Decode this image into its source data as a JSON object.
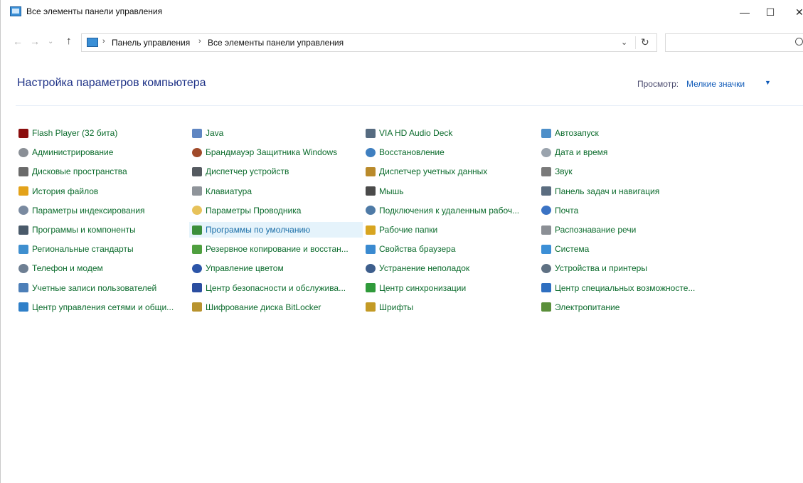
{
  "window": {
    "title": "Все элементы панели управления",
    "controls": {
      "minimize": "—",
      "maximize": "☐",
      "close": "✕"
    }
  },
  "nav": {
    "back": "←",
    "forward": "→",
    "recent": "⌄",
    "up": "↑",
    "breadcrumb_sep": "›",
    "breadcrumbs": [
      "Панель управления",
      "Все элементы панели управления"
    ],
    "dropdown": "⌄",
    "refresh": "↻",
    "search_placeholder": ""
  },
  "header": {
    "title": "Настройка параметров компьютера",
    "view_label": "Просмотр:",
    "view_value": "Мелкие значки",
    "view_caret": "▼"
  },
  "columns": [
    {
      "items": [
        {
          "label": "Flash Player (32 бита)",
          "icon": "flash-player-icon",
          "color": "#8b0d0d"
        },
        {
          "label": "Администрирование",
          "icon": "administrative-tools-icon",
          "color": "#8a8f96"
        },
        {
          "label": "Дисковые пространства",
          "icon": "storage-spaces-icon",
          "color": "#6a6a6a"
        },
        {
          "label": "История файлов",
          "icon": "file-history-icon",
          "color": "#e3a21a"
        },
        {
          "label": "Параметры индексирования",
          "icon": "indexing-options-icon",
          "color": "#7a8aa0"
        },
        {
          "label": "Программы и компоненты",
          "icon": "programs-features-icon",
          "color": "#4a5a6a"
        },
        {
          "label": "Региональные стандарты",
          "icon": "region-icon",
          "color": "#3f8fcf"
        },
        {
          "label": "Телефон и модем",
          "icon": "phone-modem-icon",
          "color": "#6e7f93"
        },
        {
          "label": "Учетные записи пользователей",
          "icon": "user-accounts-icon",
          "color": "#4d7fb8"
        },
        {
          "label": "Центр управления сетями и общи...",
          "icon": "network-center-icon",
          "color": "#2f7fc8"
        }
      ]
    },
    {
      "items": [
        {
          "label": "Java",
          "icon": "java-icon",
          "color": "#5f86c2"
        },
        {
          "label": "Брандмауэр Защитника Windows",
          "icon": "firewall-icon",
          "color": "#a04a2a"
        },
        {
          "label": "Диспетчер устройств",
          "icon": "device-manager-icon",
          "color": "#555a60"
        },
        {
          "label": "Клавиатура",
          "icon": "keyboard-icon",
          "color": "#8f949a"
        },
        {
          "label": "Параметры Проводника",
          "icon": "explorer-options-icon",
          "color": "#e7c25a"
        },
        {
          "label": "Программы по умолчанию",
          "icon": "default-programs-icon",
          "color": "#3b8f3b",
          "highlighted": true
        },
        {
          "label": "Резервное копирование и восстан...",
          "icon": "backup-restore-icon",
          "color": "#4f9f3f"
        },
        {
          "label": "Управление цветом",
          "icon": "color-management-icon",
          "color": "#2c55a8"
        },
        {
          "label": "Центр безопасности и обслужива...",
          "icon": "security-maintenance-icon",
          "color": "#2b4ea0"
        },
        {
          "label": "Шифрование диска BitLocker",
          "icon": "bitlocker-icon",
          "color": "#b8932e"
        }
      ]
    },
    {
      "items": [
        {
          "label": "VIA HD Audio Deck",
          "icon": "audio-deck-icon",
          "color": "#566b80"
        },
        {
          "label": "Восстановление",
          "icon": "recovery-icon",
          "color": "#3f7fc0"
        },
        {
          "label": "Диспетчер учетных данных",
          "icon": "credential-manager-icon",
          "color": "#b98a2b"
        },
        {
          "label": "Мышь",
          "icon": "mouse-icon",
          "color": "#4a4a4a"
        },
        {
          "label": "Подключения к удаленным рабоч...",
          "icon": "remote-desktop-icon",
          "color": "#4e7aa6"
        },
        {
          "label": "Рабочие папки",
          "icon": "work-folders-icon",
          "color": "#d8a520"
        },
        {
          "label": "Свойства браузера",
          "icon": "internet-options-icon",
          "color": "#3a8ad0"
        },
        {
          "label": "Устранение неполадок",
          "icon": "troubleshooting-icon",
          "color": "#3d5e8c"
        },
        {
          "label": "Центр синхронизации",
          "icon": "sync-center-icon",
          "color": "#2f9a3a"
        },
        {
          "label": "Шрифты",
          "icon": "fonts-icon",
          "color": "#c39a25"
        }
      ]
    },
    {
      "items": [
        {
          "label": "Автозапуск",
          "icon": "autoplay-icon",
          "color": "#4d8fc9"
        },
        {
          "label": "Дата и время",
          "icon": "date-time-icon",
          "color": "#9aa3ad"
        },
        {
          "label": "Звук",
          "icon": "sound-icon",
          "color": "#7a7a7a"
        },
        {
          "label": "Панель задач и навигация",
          "icon": "taskbar-icon",
          "color": "#5b6d80"
        },
        {
          "label": "Почта",
          "icon": "mail-icon",
          "color": "#3b73c4"
        },
        {
          "label": "Распознавание речи",
          "icon": "speech-recognition-icon",
          "color": "#8b8f95"
        },
        {
          "label": "Система",
          "icon": "system-icon",
          "color": "#3c8fd6"
        },
        {
          "label": "Устройства и принтеры",
          "icon": "devices-printers-icon",
          "color": "#5f7183"
        },
        {
          "label": "Центр специальных возможносте...",
          "icon": "ease-of-access-icon",
          "color": "#2f6fc0"
        },
        {
          "label": "Электропитание",
          "icon": "power-options-icon",
          "color": "#5a8f3a"
        }
      ]
    }
  ]
}
